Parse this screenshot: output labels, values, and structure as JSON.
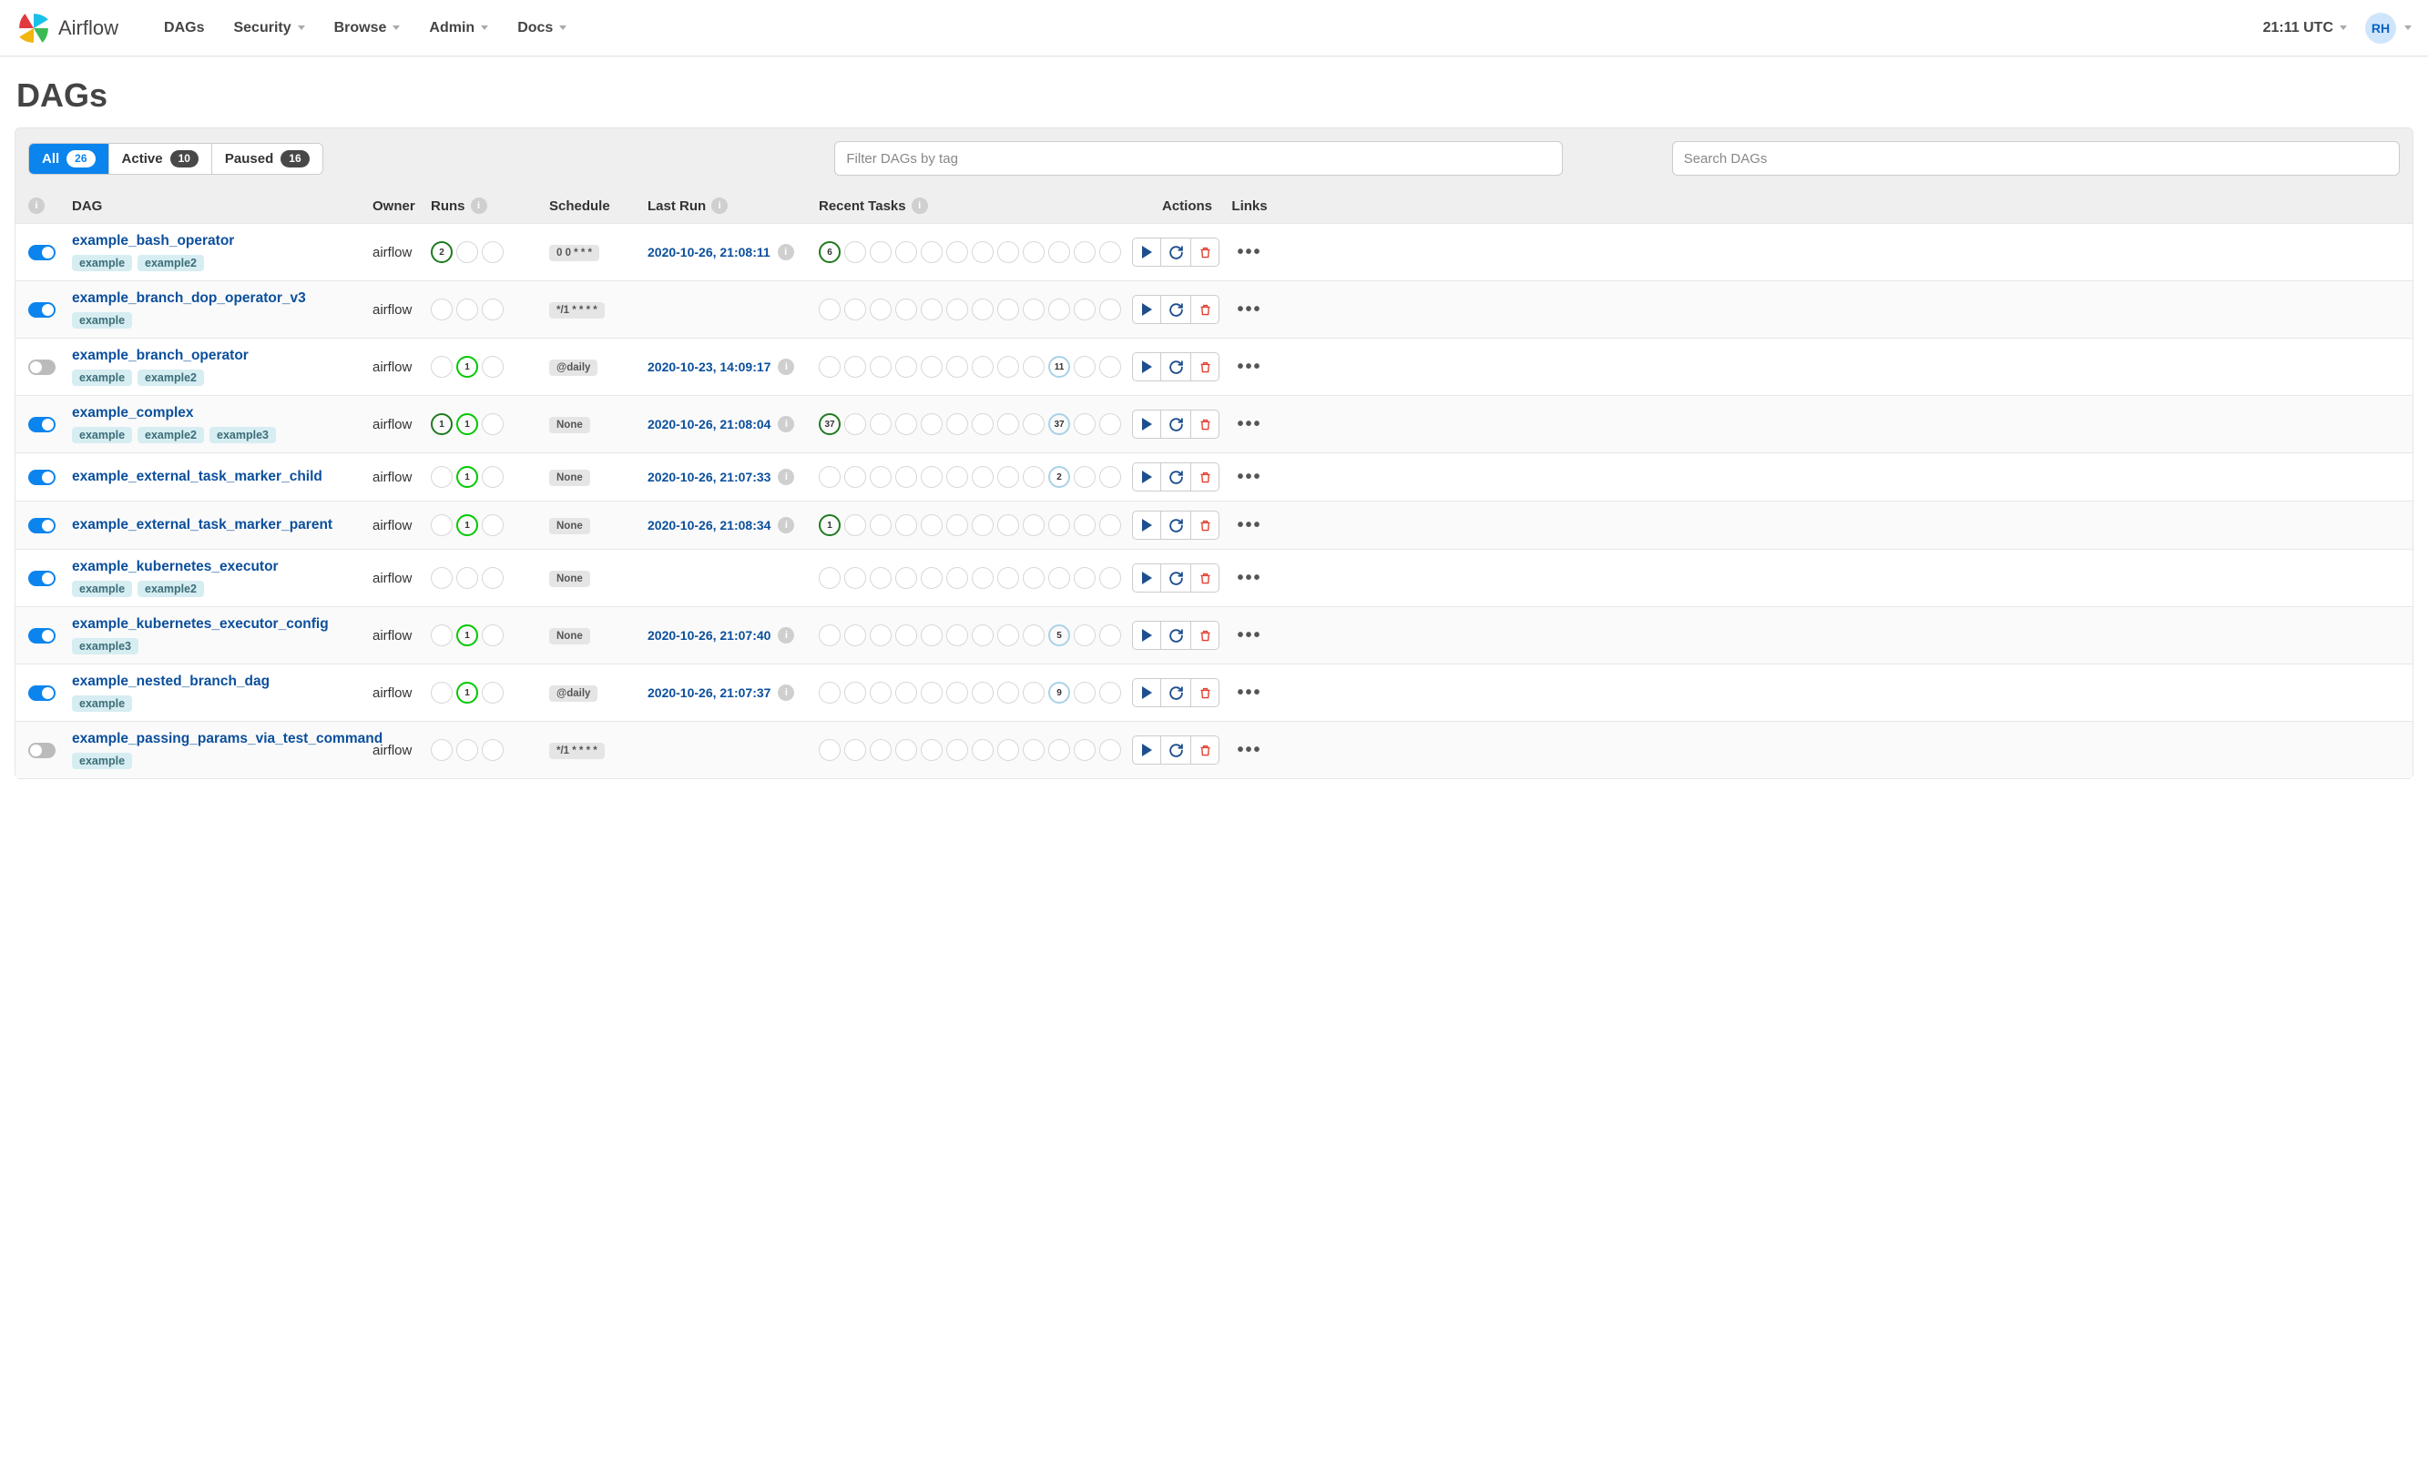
{
  "brand": "Airflow",
  "nav": {
    "items": [
      "DAGs",
      "Security",
      "Browse",
      "Admin",
      "Docs"
    ],
    "active_index": 0
  },
  "clock": "21:11 UTC",
  "user_initials": "RH",
  "page_title": "DAGs",
  "tabs": {
    "all": {
      "label": "All",
      "count": 26
    },
    "active": {
      "label": "Active",
      "count": 10
    },
    "paused": {
      "label": "Paused",
      "count": 16
    }
  },
  "filter_placeholder": "Filter DAGs by tag",
  "search_placeholder": "Search DAGs",
  "columns": {
    "dag": "DAG",
    "owner": "Owner",
    "runs": "Runs",
    "schedule": "Schedule",
    "last_run": "Last Run",
    "recent_tasks": "Recent Tasks",
    "actions": "Actions",
    "links": "Links"
  },
  "dags": [
    {
      "name": "example_bash_operator",
      "enabled": true,
      "tags": [
        "example",
        "example2"
      ],
      "owner": "airflow",
      "runs": [
        {
          "style": "dkgreen",
          "value": "2"
        },
        {
          "style": "empty"
        },
        {
          "style": "empty"
        }
      ],
      "schedule": "0 0 * * *",
      "last_run": "2020-10-26, 21:08:11",
      "tasks": [
        {
          "style": "dkgreen",
          "value": "6"
        },
        {
          "style": "empty"
        },
        {
          "style": "empty"
        },
        {
          "style": "empty"
        },
        {
          "style": "empty"
        },
        {
          "style": "empty"
        },
        {
          "style": "empty"
        },
        {
          "style": "empty"
        },
        {
          "style": "empty"
        },
        {
          "style": "empty"
        },
        {
          "style": "empty"
        },
        {
          "style": "empty"
        }
      ]
    },
    {
      "name": "example_branch_dop_operator_v3",
      "enabled": true,
      "tags": [
        "example"
      ],
      "owner": "airflow",
      "runs": [
        {
          "style": "empty"
        },
        {
          "style": "empty"
        },
        {
          "style": "empty"
        }
      ],
      "schedule": "*/1 * * * *",
      "last_run": "",
      "tasks": [
        {
          "style": "empty"
        },
        {
          "style": "empty"
        },
        {
          "style": "empty"
        },
        {
          "style": "empty"
        },
        {
          "style": "empty"
        },
        {
          "style": "empty"
        },
        {
          "style": "empty"
        },
        {
          "style": "empty"
        },
        {
          "style": "empty"
        },
        {
          "style": "empty"
        },
        {
          "style": "empty"
        },
        {
          "style": "empty"
        }
      ]
    },
    {
      "name": "example_branch_operator",
      "enabled": false,
      "tags": [
        "example",
        "example2"
      ],
      "owner": "airflow",
      "runs": [
        {
          "style": "empty"
        },
        {
          "style": "lime",
          "value": "1"
        },
        {
          "style": "empty"
        }
      ],
      "schedule": "@daily",
      "last_run": "2020-10-23, 14:09:17",
      "tasks": [
        {
          "style": "empty"
        },
        {
          "style": "empty"
        },
        {
          "style": "empty"
        },
        {
          "style": "empty"
        },
        {
          "style": "empty"
        },
        {
          "style": "empty"
        },
        {
          "style": "empty"
        },
        {
          "style": "empty"
        },
        {
          "style": "empty"
        },
        {
          "style": "lightblue",
          "value": "11"
        },
        {
          "style": "empty"
        },
        {
          "style": "empty"
        }
      ]
    },
    {
      "name": "example_complex",
      "enabled": true,
      "tags": [
        "example",
        "example2",
        "example3"
      ],
      "owner": "airflow",
      "runs": [
        {
          "style": "dkgreen",
          "value": "1"
        },
        {
          "style": "lime",
          "value": "1"
        },
        {
          "style": "empty"
        }
      ],
      "schedule": "None",
      "last_run": "2020-10-26, 21:08:04",
      "tasks": [
        {
          "style": "dkgreen",
          "value": "37"
        },
        {
          "style": "empty"
        },
        {
          "style": "empty"
        },
        {
          "style": "empty"
        },
        {
          "style": "empty"
        },
        {
          "style": "empty"
        },
        {
          "style": "empty"
        },
        {
          "style": "empty"
        },
        {
          "style": "empty"
        },
        {
          "style": "lightblue",
          "value": "37"
        },
        {
          "style": "empty"
        },
        {
          "style": "empty"
        }
      ]
    },
    {
      "name": "example_external_task_marker_child",
      "enabled": true,
      "tags": [],
      "owner": "airflow",
      "runs": [
        {
          "style": "empty"
        },
        {
          "style": "lime",
          "value": "1"
        },
        {
          "style": "empty"
        }
      ],
      "schedule": "None",
      "last_run": "2020-10-26, 21:07:33",
      "tasks": [
        {
          "style": "empty"
        },
        {
          "style": "empty"
        },
        {
          "style": "empty"
        },
        {
          "style": "empty"
        },
        {
          "style": "empty"
        },
        {
          "style": "empty"
        },
        {
          "style": "empty"
        },
        {
          "style": "empty"
        },
        {
          "style": "empty"
        },
        {
          "style": "lightblue",
          "value": "2"
        },
        {
          "style": "empty"
        },
        {
          "style": "empty"
        }
      ]
    },
    {
      "name": "example_external_task_marker_parent",
      "enabled": true,
      "tags": [],
      "owner": "airflow",
      "runs": [
        {
          "style": "empty"
        },
        {
          "style": "lime",
          "value": "1"
        },
        {
          "style": "empty"
        }
      ],
      "schedule": "None",
      "last_run": "2020-10-26, 21:08:34",
      "tasks": [
        {
          "style": "dkgreen",
          "value": "1"
        },
        {
          "style": "empty"
        },
        {
          "style": "empty"
        },
        {
          "style": "empty"
        },
        {
          "style": "empty"
        },
        {
          "style": "empty"
        },
        {
          "style": "empty"
        },
        {
          "style": "empty"
        },
        {
          "style": "empty"
        },
        {
          "style": "empty"
        },
        {
          "style": "empty"
        },
        {
          "style": "empty"
        }
      ]
    },
    {
      "name": "example_kubernetes_executor",
      "enabled": true,
      "tags": [
        "example",
        "example2"
      ],
      "owner": "airflow",
      "runs": [
        {
          "style": "empty"
        },
        {
          "style": "empty"
        },
        {
          "style": "empty"
        }
      ],
      "schedule": "None",
      "last_run": "",
      "tasks": [
        {
          "style": "empty"
        },
        {
          "style": "empty"
        },
        {
          "style": "empty"
        },
        {
          "style": "empty"
        },
        {
          "style": "empty"
        },
        {
          "style": "empty"
        },
        {
          "style": "empty"
        },
        {
          "style": "empty"
        },
        {
          "style": "empty"
        },
        {
          "style": "empty"
        },
        {
          "style": "empty"
        },
        {
          "style": "empty"
        }
      ]
    },
    {
      "name": "example_kubernetes_executor_config",
      "enabled": true,
      "tags": [
        "example3"
      ],
      "owner": "airflow",
      "runs": [
        {
          "style": "empty"
        },
        {
          "style": "lime",
          "value": "1"
        },
        {
          "style": "empty"
        }
      ],
      "schedule": "None",
      "last_run": "2020-10-26, 21:07:40",
      "tasks": [
        {
          "style": "empty"
        },
        {
          "style": "empty"
        },
        {
          "style": "empty"
        },
        {
          "style": "empty"
        },
        {
          "style": "empty"
        },
        {
          "style": "empty"
        },
        {
          "style": "empty"
        },
        {
          "style": "empty"
        },
        {
          "style": "empty"
        },
        {
          "style": "lightblue",
          "value": "5"
        },
        {
          "style": "empty"
        },
        {
          "style": "empty"
        }
      ]
    },
    {
      "name": "example_nested_branch_dag",
      "enabled": true,
      "tags": [
        "example"
      ],
      "owner": "airflow",
      "runs": [
        {
          "style": "empty"
        },
        {
          "style": "lime",
          "value": "1"
        },
        {
          "style": "empty"
        }
      ],
      "schedule": "@daily",
      "last_run": "2020-10-26, 21:07:37",
      "tasks": [
        {
          "style": "empty"
        },
        {
          "style": "empty"
        },
        {
          "style": "empty"
        },
        {
          "style": "empty"
        },
        {
          "style": "empty"
        },
        {
          "style": "empty"
        },
        {
          "style": "empty"
        },
        {
          "style": "empty"
        },
        {
          "style": "empty"
        },
        {
          "style": "lightblue",
          "value": "9"
        },
        {
          "style": "empty"
        },
        {
          "style": "empty"
        }
      ]
    },
    {
      "name": "example_passing_params_via_test_command",
      "enabled": false,
      "tags": [
        "example"
      ],
      "owner": "airflow",
      "runs": [
        {
          "style": "empty"
        },
        {
          "style": "empty"
        },
        {
          "style": "empty"
        }
      ],
      "schedule": "*/1 * * * *",
      "last_run": "",
      "tasks": [
        {
          "style": "empty"
        },
        {
          "style": "empty"
        },
        {
          "style": "empty"
        },
        {
          "style": "empty"
        },
        {
          "style": "empty"
        },
        {
          "style": "empty"
        },
        {
          "style": "empty"
        },
        {
          "style": "empty"
        },
        {
          "style": "empty"
        },
        {
          "style": "empty"
        },
        {
          "style": "empty"
        },
        {
          "style": "empty"
        }
      ]
    }
  ]
}
